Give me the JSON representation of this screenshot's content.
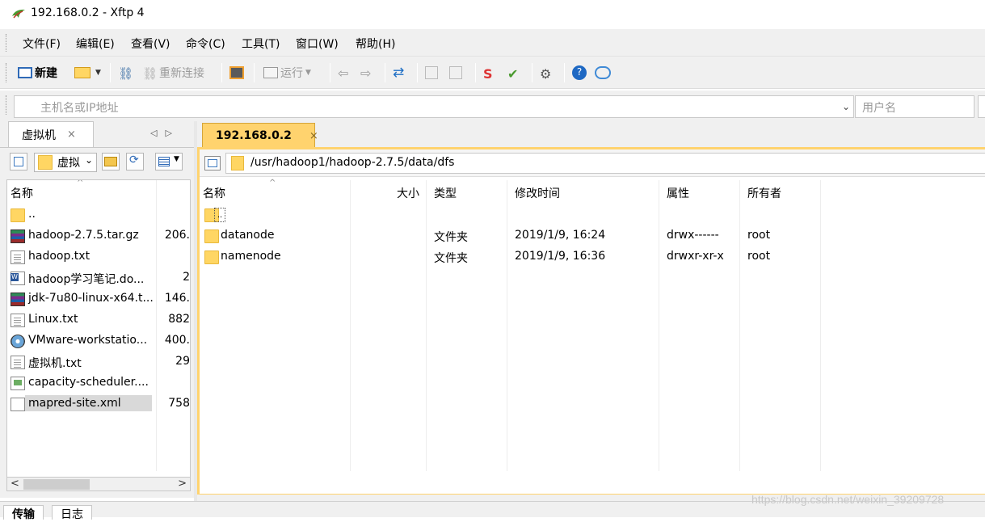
{
  "window": {
    "title": "192.168.0.2 - Xftp 4"
  },
  "menu": [
    "文件(F)",
    "编辑(E)",
    "查看(V)",
    "命令(C)",
    "工具(T)",
    "窗口(W)",
    "帮助(H)"
  ],
  "toolbar": {
    "new_label": "新建",
    "reconnect_label": "重新连接",
    "run_label": "运行"
  },
  "address": {
    "host_placeholder": "主机名或IP地址",
    "user_placeholder": "用户名"
  },
  "left": {
    "tab_label": "虚拟机",
    "location_value": "虚拟",
    "columns": {
      "name": "名称"
    },
    "files": [
      {
        "name": "..",
        "size": "",
        "icon": "folder-icon"
      },
      {
        "name": "hadoop-2.7.5.tar.gz",
        "size": "206.",
        "icon": "archive-icon"
      },
      {
        "name": "hadoop.txt",
        "size": "",
        "icon": "text-file-icon"
      },
      {
        "name": "hadoop学习笔记.do...",
        "size": "2",
        "icon": "word-file-icon"
      },
      {
        "name": "jdk-7u80-linux-x64.t...",
        "size": "146.",
        "icon": "archive-icon"
      },
      {
        "name": "Linux.txt",
        "size": "882",
        "icon": "text-file-icon"
      },
      {
        "name": "VMware-workstatio...",
        "size": "400.",
        "icon": "installer-icon"
      },
      {
        "name": "虚拟机.txt",
        "size": "29",
        "icon": "text-file-icon"
      },
      {
        "name": "capacity-scheduler....",
        "size": "",
        "icon": "xml-file-icon"
      },
      {
        "name": "mapred-site.xml",
        "size": "758",
        "icon": "blank-file-icon"
      }
    ]
  },
  "right": {
    "tab_label": "192.168.0.2",
    "path": "/usr/hadoop1/hadoop-2.7.5/data/dfs",
    "columns": {
      "name": "名称",
      "size": "大小",
      "type": "类型",
      "modified": "修改时间",
      "attrs": "属性",
      "owner": "所有者"
    },
    "files": [
      {
        "name": "",
        "type": "",
        "modified": "",
        "attrs": "",
        "owner": ""
      },
      {
        "name": "datanode",
        "type": "文件夹",
        "modified": "2019/1/9, 16:24",
        "attrs": "drwx------",
        "owner": "root"
      },
      {
        "name": "namenode",
        "type": "文件夹",
        "modified": "2019/1/9, 16:36",
        "attrs": "drwxr-xr-x",
        "owner": "root"
      }
    ]
  },
  "bottom_tabs": [
    "传输",
    "日志"
  ],
  "watermark": "https://blog.csdn.net/weixin_39209728",
  "colors": {
    "accent_tab": "#ffd36e",
    "folder": "#ffd663",
    "selection": "#d9d9d9"
  }
}
